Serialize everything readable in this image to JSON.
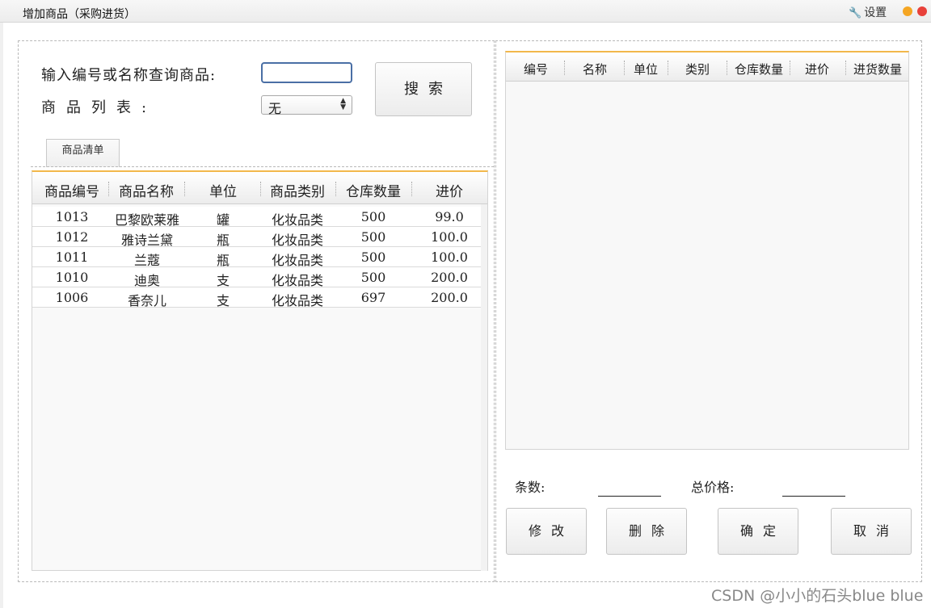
{
  "window": {
    "title": "增加商品（采购进货）",
    "settings_label": "设置"
  },
  "search": {
    "query_label": "输入编号或名称查询商品:",
    "list_label": "商品列表:",
    "select_value": "无",
    "search_button": "搜索",
    "input_value": ""
  },
  "tab": {
    "label": "商品清单"
  },
  "left_table": {
    "columns": [
      "商品编号",
      "商品名称",
      "单位",
      "商品类别",
      "仓库数量",
      "进价"
    ],
    "rows": [
      [
        "1013",
        "巴黎欧莱雅",
        "罐",
        "化妆品类",
        "500",
        "99.0"
      ],
      [
        "1012",
        "雅诗兰黛",
        "瓶",
        "化妆品类",
        "500",
        "100.0"
      ],
      [
        "1011",
        "兰蔻",
        "瓶",
        "化妆品类",
        "500",
        "100.0"
      ],
      [
        "1010",
        "迪奥",
        "支",
        "化妆品类",
        "500",
        "200.0"
      ],
      [
        "1006",
        "香奈儿",
        "支",
        "化妆品类",
        "697",
        "200.0"
      ]
    ]
  },
  "right_table": {
    "columns": [
      "编号",
      "名称",
      "单位",
      "类别",
      "仓库数量",
      "进价",
      "进货数量"
    ]
  },
  "summary": {
    "count_label": "条数:",
    "count_value": "",
    "total_label": "总价格:",
    "total_value": ""
  },
  "actions": {
    "modify": "修改",
    "delete": "删除",
    "confirm": "确定",
    "cancel": "取消"
  },
  "watermark": "CSDN @小小的石头blue blue",
  "colors": {
    "accent": "#f2b84b",
    "input_border": "#4a6fa5",
    "close": "#e8413a",
    "minimize": "#f5a623"
  }
}
